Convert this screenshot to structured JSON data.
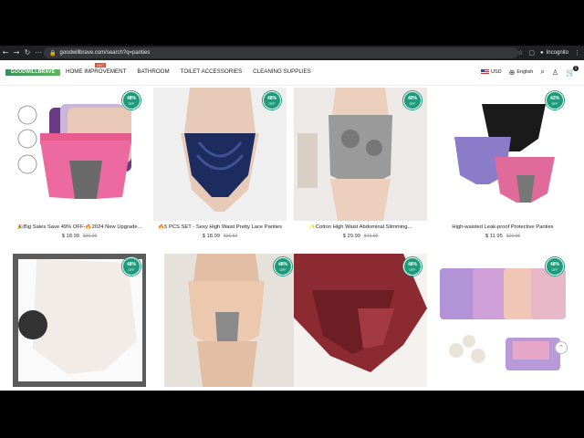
{
  "browser": {
    "url": "goodwillbrave.com/search?q=panties",
    "incognito_label": "Incognito",
    "tab_count": "1"
  },
  "header": {
    "logo_text": "GOODWILLBRAVE",
    "menu": [
      {
        "label": "HOME IMPROVEMENT",
        "badge": "HOT"
      },
      {
        "label": "BATHROOM"
      },
      {
        "label": "TOILET ACCESSORIES"
      },
      {
        "label": "CLEANING SUPPLIES"
      }
    ],
    "currency": "USD",
    "language": "English",
    "cart_count": "1"
  },
  "products": [
    {
      "title": "🎉Big Sales Save 49% OFF-🔥2024 New Upgrade...",
      "price": "$ 18.99",
      "old_price": "$36.99",
      "discount": "48%",
      "off": "OFF"
    },
    {
      "title": "🔥5 PCS SET - Sexy High Waist Pretty Lace Panties",
      "price": "$ 18.99",
      "old_price": "$36.52",
      "discount": "48%",
      "off": "OFF"
    },
    {
      "title": "✨Cotton High Waist Abdominal Slimming...",
      "price": "$ 29.99",
      "old_price": "$49.99",
      "discount": "40%",
      "off": "OFF"
    },
    {
      "title": "High-waisted Leak-proof Protective Panties",
      "price": "$ 11.95",
      "old_price": "$20.95",
      "discount": "42%",
      "off": "OFF"
    },
    {
      "title": "",
      "price": "",
      "old_price": "",
      "discount": "48%",
      "off": "OFF"
    },
    {
      "title": "",
      "price": "",
      "old_price": "",
      "discount": "48%",
      "off": "OFF"
    },
    {
      "title": "",
      "price": "",
      "old_price": "",
      "discount": "48%",
      "off": "OFF"
    },
    {
      "title": "",
      "price": "",
      "old_price": "",
      "discount": "48%",
      "off": "OFF"
    }
  ],
  "colors": {
    "badge": "#1e9b7b",
    "hot": "#e84b2b",
    "chrome": "#202124"
  }
}
